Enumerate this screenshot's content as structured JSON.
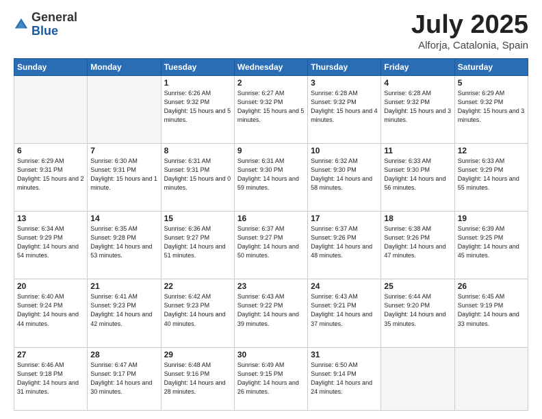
{
  "header": {
    "logo": {
      "general": "General",
      "blue": "Blue"
    },
    "title": "July 2025",
    "location": "Alforja, Catalonia, Spain"
  },
  "weekdays": [
    "Sunday",
    "Monday",
    "Tuesday",
    "Wednesday",
    "Thursday",
    "Friday",
    "Saturday"
  ],
  "weeks": [
    [
      {
        "day": "",
        "info": ""
      },
      {
        "day": "",
        "info": ""
      },
      {
        "day": "1",
        "info": "Sunrise: 6:26 AM\nSunset: 9:32 PM\nDaylight: 15 hours\nand 5 minutes."
      },
      {
        "day": "2",
        "info": "Sunrise: 6:27 AM\nSunset: 9:32 PM\nDaylight: 15 hours\nand 5 minutes."
      },
      {
        "day": "3",
        "info": "Sunrise: 6:28 AM\nSunset: 9:32 PM\nDaylight: 15 hours\nand 4 minutes."
      },
      {
        "day": "4",
        "info": "Sunrise: 6:28 AM\nSunset: 9:32 PM\nDaylight: 15 hours\nand 3 minutes."
      },
      {
        "day": "5",
        "info": "Sunrise: 6:29 AM\nSunset: 9:32 PM\nDaylight: 15 hours\nand 3 minutes."
      }
    ],
    [
      {
        "day": "6",
        "info": "Sunrise: 6:29 AM\nSunset: 9:31 PM\nDaylight: 15 hours\nand 2 minutes."
      },
      {
        "day": "7",
        "info": "Sunrise: 6:30 AM\nSunset: 9:31 PM\nDaylight: 15 hours\nand 1 minute."
      },
      {
        "day": "8",
        "info": "Sunrise: 6:31 AM\nSunset: 9:31 PM\nDaylight: 15 hours\nand 0 minutes."
      },
      {
        "day": "9",
        "info": "Sunrise: 6:31 AM\nSunset: 9:30 PM\nDaylight: 14 hours\nand 59 minutes."
      },
      {
        "day": "10",
        "info": "Sunrise: 6:32 AM\nSunset: 9:30 PM\nDaylight: 14 hours\nand 58 minutes."
      },
      {
        "day": "11",
        "info": "Sunrise: 6:33 AM\nSunset: 9:30 PM\nDaylight: 14 hours\nand 56 minutes."
      },
      {
        "day": "12",
        "info": "Sunrise: 6:33 AM\nSunset: 9:29 PM\nDaylight: 14 hours\nand 55 minutes."
      }
    ],
    [
      {
        "day": "13",
        "info": "Sunrise: 6:34 AM\nSunset: 9:29 PM\nDaylight: 14 hours\nand 54 minutes."
      },
      {
        "day": "14",
        "info": "Sunrise: 6:35 AM\nSunset: 9:28 PM\nDaylight: 14 hours\nand 53 minutes."
      },
      {
        "day": "15",
        "info": "Sunrise: 6:36 AM\nSunset: 9:27 PM\nDaylight: 14 hours\nand 51 minutes."
      },
      {
        "day": "16",
        "info": "Sunrise: 6:37 AM\nSunset: 9:27 PM\nDaylight: 14 hours\nand 50 minutes."
      },
      {
        "day": "17",
        "info": "Sunrise: 6:37 AM\nSunset: 9:26 PM\nDaylight: 14 hours\nand 48 minutes."
      },
      {
        "day": "18",
        "info": "Sunrise: 6:38 AM\nSunset: 9:26 PM\nDaylight: 14 hours\nand 47 minutes."
      },
      {
        "day": "19",
        "info": "Sunrise: 6:39 AM\nSunset: 9:25 PM\nDaylight: 14 hours\nand 45 minutes."
      }
    ],
    [
      {
        "day": "20",
        "info": "Sunrise: 6:40 AM\nSunset: 9:24 PM\nDaylight: 14 hours\nand 44 minutes."
      },
      {
        "day": "21",
        "info": "Sunrise: 6:41 AM\nSunset: 9:23 PM\nDaylight: 14 hours\nand 42 minutes."
      },
      {
        "day": "22",
        "info": "Sunrise: 6:42 AM\nSunset: 9:23 PM\nDaylight: 14 hours\nand 40 minutes."
      },
      {
        "day": "23",
        "info": "Sunrise: 6:43 AM\nSunset: 9:22 PM\nDaylight: 14 hours\nand 39 minutes."
      },
      {
        "day": "24",
        "info": "Sunrise: 6:43 AM\nSunset: 9:21 PM\nDaylight: 14 hours\nand 37 minutes."
      },
      {
        "day": "25",
        "info": "Sunrise: 6:44 AM\nSunset: 9:20 PM\nDaylight: 14 hours\nand 35 minutes."
      },
      {
        "day": "26",
        "info": "Sunrise: 6:45 AM\nSunset: 9:19 PM\nDaylight: 14 hours\nand 33 minutes."
      }
    ],
    [
      {
        "day": "27",
        "info": "Sunrise: 6:46 AM\nSunset: 9:18 PM\nDaylight: 14 hours\nand 31 minutes."
      },
      {
        "day": "28",
        "info": "Sunrise: 6:47 AM\nSunset: 9:17 PM\nDaylight: 14 hours\nand 30 minutes."
      },
      {
        "day": "29",
        "info": "Sunrise: 6:48 AM\nSunset: 9:16 PM\nDaylight: 14 hours\nand 28 minutes."
      },
      {
        "day": "30",
        "info": "Sunrise: 6:49 AM\nSunset: 9:15 PM\nDaylight: 14 hours\nand 26 minutes."
      },
      {
        "day": "31",
        "info": "Sunrise: 6:50 AM\nSunset: 9:14 PM\nDaylight: 14 hours\nand 24 minutes."
      },
      {
        "day": "",
        "info": ""
      },
      {
        "day": "",
        "info": ""
      }
    ]
  ]
}
